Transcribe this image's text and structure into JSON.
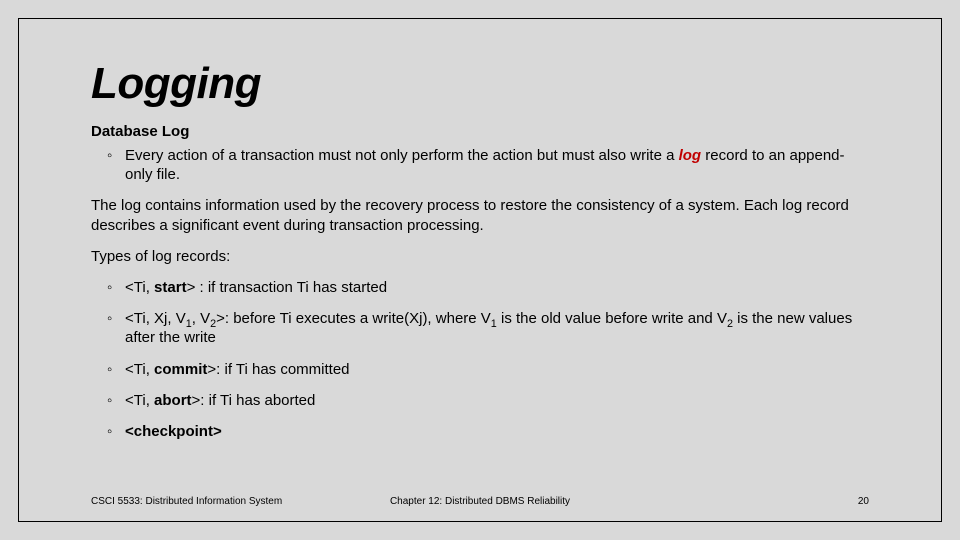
{
  "title": "Logging",
  "section_head": "Database Log",
  "intro_bullet_pre": "Every action of a transaction must not only perform the action but must also write a ",
  "intro_bullet_log_word": "log",
  "intro_bullet_post": " record to an append-only file.",
  "para1": "The log contains information used by the recovery process to restore the consistency of a system. Each log record describes a significant event during transaction processing.",
  "types_head": "Types of log records:",
  "rec_start_pre": "<Ti, ",
  "rec_start_bold": "start",
  "rec_start_post": "> : if transaction Ti has started",
  "rec_write_pre": "<Ti, Xj, V",
  "rec_write_sub1": "1",
  "rec_write_mid1": ", V",
  "rec_write_sub2": "2",
  "rec_write_mid2": ">: before Ti executes a write(Xj), where V",
  "rec_write_sub3": "1",
  "rec_write_mid3": " is the old value before write and V",
  "rec_write_sub4": "2",
  "rec_write_post": " is the new values after the write",
  "rec_commit_pre": "<Ti, ",
  "rec_commit_bold": "commit",
  "rec_commit_post": ">: if Ti has committed",
  "rec_abort_pre": "<Ti, ",
  "rec_abort_bold": "abort",
  "rec_abort_post": ">: if Ti has aborted",
  "rec_checkpoint": "<checkpoint>",
  "footer_left": "CSCI 5533: Distributed Information System",
  "footer_center": "Chapter 12: Distributed DBMS Reliability",
  "footer_right": "20"
}
